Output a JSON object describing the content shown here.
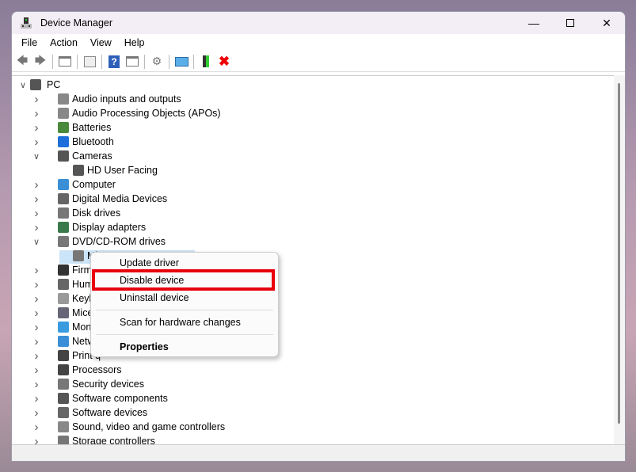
{
  "window": {
    "title": "Device Manager",
    "controls": [
      "minimize",
      "maximize",
      "close"
    ]
  },
  "menubar": [
    "File",
    "Action",
    "View",
    "Help"
  ],
  "toolbar": [
    "back-icon",
    "forward-icon",
    "show-hide-console-tree-icon",
    "properties-icon",
    "help-icon",
    "action-pane-icon",
    "update-driver-icon",
    "scan-hardware-icon",
    "enable-device-icon",
    "uninstall-icon"
  ],
  "tree": {
    "root": "PC",
    "items": [
      {
        "label": "Audio inputs and outputs",
        "state": "collapsed",
        "color": "#888"
      },
      {
        "label": "Audio Processing Objects (APOs)",
        "state": "collapsed",
        "color": "#888"
      },
      {
        "label": "Batteries",
        "state": "collapsed",
        "color": "#4a8a3a"
      },
      {
        "label": "Bluetooth",
        "state": "collapsed",
        "color": "#1e6fd9"
      },
      {
        "label": "Cameras",
        "state": "expanded",
        "color": "#555"
      },
      {
        "label": "HD User Facing",
        "child": true,
        "color": "#555"
      },
      {
        "label": "Computer",
        "state": "collapsed",
        "color": "#3a8fd6"
      },
      {
        "label": "Digital Media Devices",
        "state": "collapsed",
        "color": "#666"
      },
      {
        "label": "Disk drives",
        "state": "collapsed",
        "color": "#777"
      },
      {
        "label": "Display adapters",
        "state": "collapsed",
        "color": "#3a7a4a"
      },
      {
        "label": "DVD/CD-ROM drives",
        "state": "expanded",
        "color": "#777"
      },
      {
        "label": "Mic",
        "child": true,
        "selected": true,
        "color": "#777"
      },
      {
        "label": "Firmwa",
        "state": "collapsed",
        "color": "#333"
      },
      {
        "label": "Human",
        "state": "collapsed",
        "color": "#666"
      },
      {
        "label": "Keybo",
        "state": "collapsed",
        "color": "#999"
      },
      {
        "label": "Mice a",
        "state": "collapsed",
        "color": "#667"
      },
      {
        "label": "Monito",
        "state": "collapsed",
        "color": "#3a9be0"
      },
      {
        "label": "Netwo",
        "state": "collapsed",
        "color": "#3a8fd6"
      },
      {
        "label": "Print q",
        "state": "collapsed",
        "color": "#444"
      },
      {
        "label": "Processors",
        "state": "collapsed",
        "color": "#444"
      },
      {
        "label": "Security devices",
        "state": "collapsed",
        "color": "#777"
      },
      {
        "label": "Software components",
        "state": "collapsed",
        "color": "#555"
      },
      {
        "label": "Software devices",
        "state": "collapsed",
        "color": "#666"
      },
      {
        "label": "Sound, video and game controllers",
        "state": "collapsed",
        "color": "#888"
      },
      {
        "label": "Storage controllers",
        "state": "collapsed",
        "color": "#777"
      }
    ]
  },
  "context_menu": {
    "items": [
      "Update driver",
      "Disable device",
      "Uninstall device",
      "Scan for hardware changes",
      "Properties"
    ],
    "highlighted": "Disable device",
    "highlight_color": "#e8000c"
  }
}
